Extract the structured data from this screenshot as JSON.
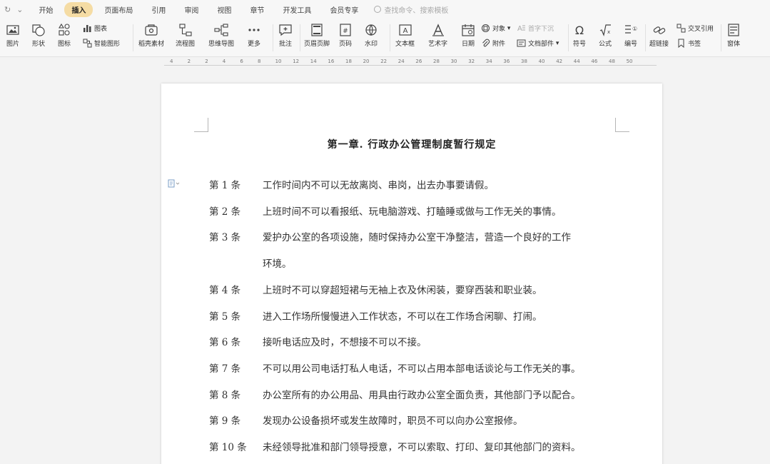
{
  "menubar": {
    "items": [
      "开始",
      "插入",
      "页面布局",
      "引用",
      "审阅",
      "视图",
      "章节",
      "开发工具",
      "会员专享"
    ],
    "active_index": 1,
    "search_placeholder": "查找命令、搜索模板",
    "accent_color": "#f5dca4"
  },
  "ribbon": {
    "picture": "图片",
    "shape": "形状",
    "icon": "图标",
    "chart": "图表",
    "smart_art": "智能图形",
    "docer_material": "稻壳素材",
    "flowchart": "流程图",
    "mindmap": "思维导图",
    "more": "更多",
    "comment": "批注",
    "header_footer": "页眉页脚",
    "page_number": "页码",
    "watermark": "水印",
    "textbox": "文本框",
    "wordart": "艺术字",
    "date": "日期",
    "object": "对象",
    "drop_cap": "首字下沉",
    "attachment": "附件",
    "doc_parts": "文档部件",
    "symbol": "符号",
    "formula": "公式",
    "numbering": "编号",
    "hyperlink": "超链接",
    "cross_ref": "交叉引用",
    "bookmark": "书签",
    "form": "窗体"
  },
  "ruler": {
    "labels": [
      "4",
      "2",
      "2",
      "4",
      "6",
      "8",
      "10",
      "12",
      "14",
      "16",
      "18",
      "20",
      "22",
      "24",
      "26",
      "28",
      "30",
      "32",
      "34",
      "36",
      "38",
      "40",
      "42",
      "44",
      "46",
      "48",
      "50"
    ]
  },
  "document": {
    "title": "第一章. 行政办公管理制度暂行规定",
    "articles": [
      {
        "num": "第 1 条",
        "lines": [
          "工作时间内不可以无故离岗、串岗，出去办事要请假。"
        ]
      },
      {
        "num": "第 2 条",
        "lines": [
          "上班时间不可以看报纸、玩电脑游戏、打瞌睡或做与工作无关的事情。"
        ]
      },
      {
        "num": "第 3 条",
        "lines": [
          "爱护办公室的各项设施，随时保持办公室干净整洁，营造一个良好的工作",
          "环境。"
        ]
      },
      {
        "num": "第 4 条",
        "lines": [
          "上班时不可以穿超短裙与无袖上衣及休闲装，要穿西装和职业装。"
        ]
      },
      {
        "num": "第 5 条",
        "lines": [
          "进入工作场所慢慢进入工作状态，不可以在工作场合闲聊、打闹。"
        ]
      },
      {
        "num": "第 6 条",
        "lines": [
          "接听电话应及时，不想接不可以不接。"
        ]
      },
      {
        "num": "第 7 条",
        "lines": [
          "不可以用公司电话打私人电话，不可以占用本部电话谈论与工作无关的事。"
        ]
      },
      {
        "num": "第 8 条",
        "lines": [
          "办公室所有的办公用品、用具由行政办公室全面负责，其他部门予以配合。"
        ]
      },
      {
        "num": "第 9 条",
        "lines": [
          "发现办公设备损坏或发生故障时，职员不可以向办公室报修。"
        ]
      },
      {
        "num": "第 10 条",
        "lines": [
          "未经领导批准和部门领导授意，不可以索取、打印、复印其他部门的资料。"
        ]
      }
    ]
  }
}
